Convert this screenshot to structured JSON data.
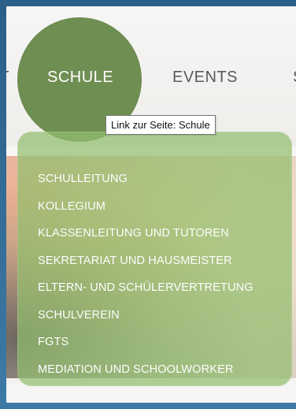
{
  "nav": {
    "left_edge_fragment": "T",
    "schule_label": "SCHULE",
    "events_label": "EVENTS",
    "right_edge_fragment": "S"
  },
  "tooltip": {
    "text": "Link zur Seite: Schule"
  },
  "dropdown": {
    "items": [
      "SCHULLEITUNG",
      "KOLLEGIUM",
      "KLASSENLEITUNG UND TUTOREN",
      "SEKRETARIAT UND HAUSMEISTER",
      "ELTERN- UND SCHÜLERVERTRETUNG",
      "SCHULVEREIN",
      "FGTS",
      "MEDIATION UND SCHOOLWORKER"
    ]
  },
  "colors": {
    "nav_active_circle": "#6f8e52",
    "dropdown_bg": "#91be6e",
    "nav_text": "#585858"
  }
}
